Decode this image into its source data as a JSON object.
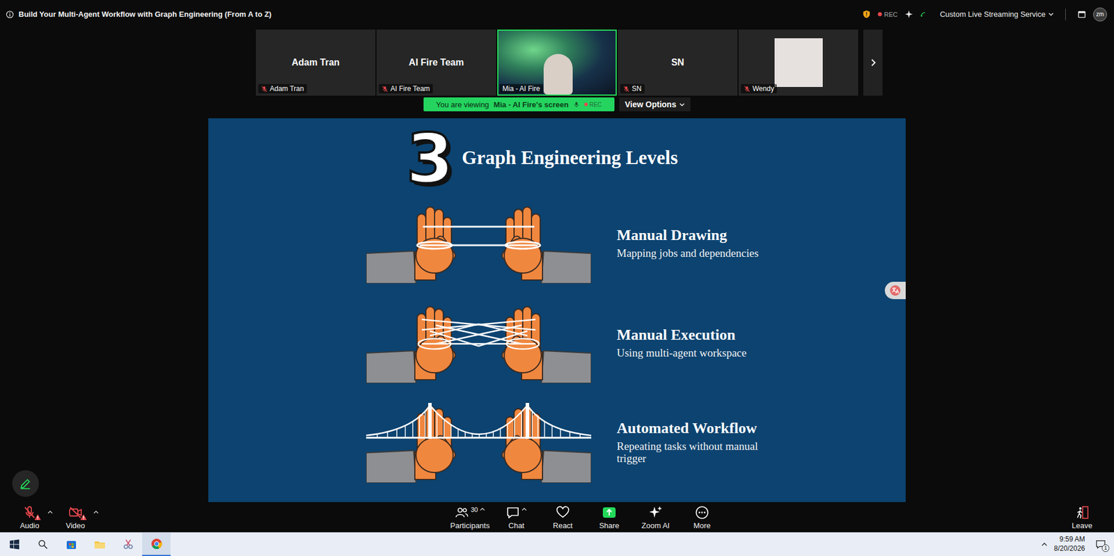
{
  "window": {
    "title": "Build Your Multi-Agent Workflow with Graph Engineering (From A to Z)"
  },
  "topbar": {
    "rec": "REC",
    "streaming": "Custom Live Streaming Service",
    "avatar": "zm"
  },
  "participants": [
    {
      "name": "Adam Tran",
      "kind": "name",
      "muted": true,
      "speaking": false
    },
    {
      "name": "AI Fire Team",
      "kind": "name",
      "muted": true,
      "speaking": false
    },
    {
      "name": "Mia - AI Fire",
      "kind": "video",
      "muted": false,
      "speaking": true
    },
    {
      "name": "SN",
      "kind": "name",
      "muted": true,
      "speaking": false
    },
    {
      "name": "Wendy",
      "kind": "photo",
      "muted": true,
      "speaking": false
    }
  ],
  "banner": {
    "prefix": "You are viewing",
    "presenter": "Mia - AI Fire's screen",
    "rec": "REC",
    "view_options": "View Options"
  },
  "slide": {
    "number": "3",
    "title": "Graph Engineering Levels",
    "levels": [
      {
        "title": "Manual Drawing",
        "subtitle": "Mapping jobs and dependencies",
        "kind": "strings"
      },
      {
        "title": "Manual Execution",
        "subtitle": "Using multi-agent workspace",
        "kind": "cradle"
      },
      {
        "title": "Automated Workflow",
        "subtitle": "Repeating tasks without manual trigger",
        "kind": "bridge"
      }
    ]
  },
  "toolbar": {
    "audio": {
      "label": "Audio",
      "muted": true,
      "warning": true
    },
    "video": {
      "label": "Video",
      "off": true,
      "warning": true
    },
    "participants": {
      "label": "Participants",
      "count": "30"
    },
    "chat": {
      "label": "Chat"
    },
    "react": {
      "label": "React"
    },
    "share": {
      "label": "Share"
    },
    "zoom_ai": {
      "label": "Zoom AI"
    },
    "more": {
      "label": "More"
    },
    "leave": {
      "label": "Leave"
    }
  },
  "taskbar": {
    "time": "9:59 AM",
    "date": "8/20/2026",
    "notifications": "1"
  }
}
